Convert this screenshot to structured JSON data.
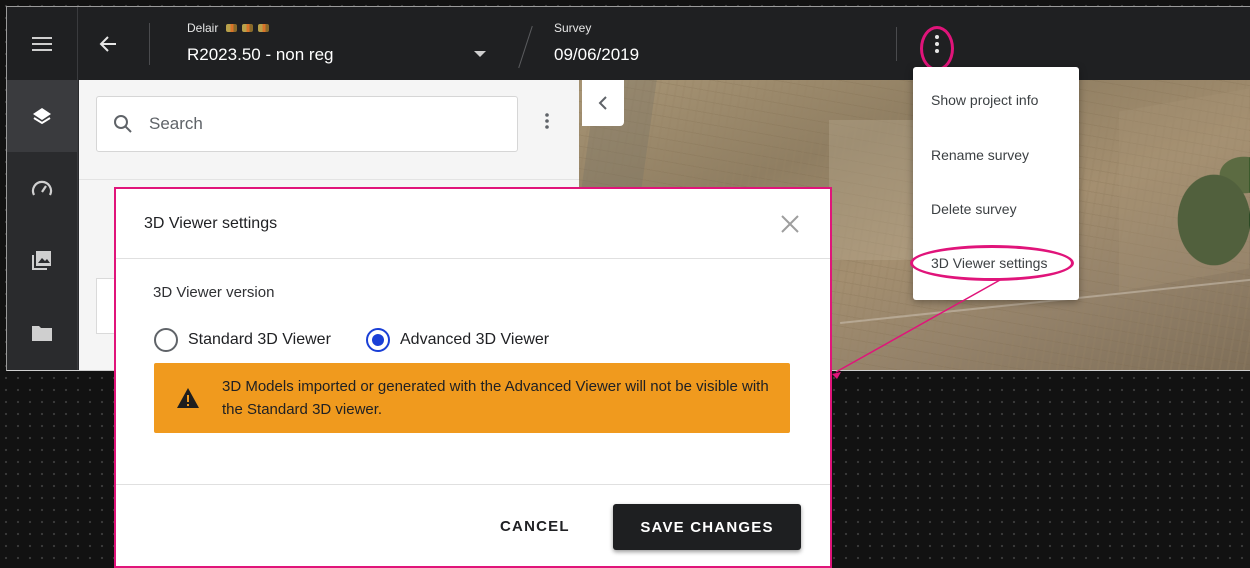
{
  "header": {
    "project_label": "Delair",
    "project_value": "R2023.50 - non reg",
    "survey_label": "Survey",
    "survey_value": "09/06/2019"
  },
  "sidebar": {
    "items": [
      {
        "icon": "layers-icon"
      },
      {
        "icon": "speedometer-icon"
      },
      {
        "icon": "image-gallery-icon"
      },
      {
        "icon": "folder-icon"
      }
    ]
  },
  "panel": {
    "search_placeholder": "Search"
  },
  "menu": {
    "items": [
      {
        "label": "Show project info"
      },
      {
        "label": "Rename survey"
      },
      {
        "label": "Delete survey"
      },
      {
        "label": "3D Viewer settings"
      }
    ]
  },
  "dialog": {
    "title": "3D Viewer settings",
    "version_label": "3D Viewer version",
    "options": [
      {
        "label": "Standard 3D Viewer",
        "checked": false
      },
      {
        "label": "Advanced 3D Viewer",
        "checked": true
      }
    ],
    "warning": "3D Models imported or generated with the Advanced Viewer will not be visible with the Standard 3D viewer.",
    "cancel_label": "CANCEL",
    "save_label": "SAVE CHANGES"
  },
  "colors": {
    "annotation": "#e0147a",
    "radio_accent": "#1a3fd6",
    "warning_bg": "#f09a1e",
    "topbar_bg": "#1f2022"
  }
}
